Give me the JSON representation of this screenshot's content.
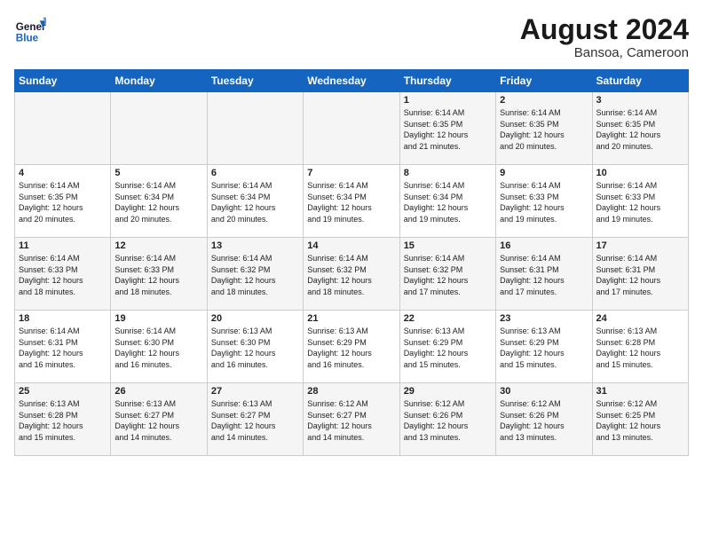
{
  "header": {
    "logo_general": "General",
    "logo_blue": "Blue",
    "month_year": "August 2024",
    "location": "Bansoa, Cameroon"
  },
  "weekdays": [
    "Sunday",
    "Monday",
    "Tuesday",
    "Wednesday",
    "Thursday",
    "Friday",
    "Saturday"
  ],
  "weeks": [
    [
      {
        "day": "",
        "info": ""
      },
      {
        "day": "",
        "info": ""
      },
      {
        "day": "",
        "info": ""
      },
      {
        "day": "",
        "info": ""
      },
      {
        "day": "1",
        "info": "Sunrise: 6:14 AM\nSunset: 6:35 PM\nDaylight: 12 hours\nand 21 minutes."
      },
      {
        "day": "2",
        "info": "Sunrise: 6:14 AM\nSunset: 6:35 PM\nDaylight: 12 hours\nand 20 minutes."
      },
      {
        "day": "3",
        "info": "Sunrise: 6:14 AM\nSunset: 6:35 PM\nDaylight: 12 hours\nand 20 minutes."
      }
    ],
    [
      {
        "day": "4",
        "info": "Sunrise: 6:14 AM\nSunset: 6:35 PM\nDaylight: 12 hours\nand 20 minutes."
      },
      {
        "day": "5",
        "info": "Sunrise: 6:14 AM\nSunset: 6:34 PM\nDaylight: 12 hours\nand 20 minutes."
      },
      {
        "day": "6",
        "info": "Sunrise: 6:14 AM\nSunset: 6:34 PM\nDaylight: 12 hours\nand 20 minutes."
      },
      {
        "day": "7",
        "info": "Sunrise: 6:14 AM\nSunset: 6:34 PM\nDaylight: 12 hours\nand 19 minutes."
      },
      {
        "day": "8",
        "info": "Sunrise: 6:14 AM\nSunset: 6:34 PM\nDaylight: 12 hours\nand 19 minutes."
      },
      {
        "day": "9",
        "info": "Sunrise: 6:14 AM\nSunset: 6:33 PM\nDaylight: 12 hours\nand 19 minutes."
      },
      {
        "day": "10",
        "info": "Sunrise: 6:14 AM\nSunset: 6:33 PM\nDaylight: 12 hours\nand 19 minutes."
      }
    ],
    [
      {
        "day": "11",
        "info": "Sunrise: 6:14 AM\nSunset: 6:33 PM\nDaylight: 12 hours\nand 18 minutes."
      },
      {
        "day": "12",
        "info": "Sunrise: 6:14 AM\nSunset: 6:33 PM\nDaylight: 12 hours\nand 18 minutes."
      },
      {
        "day": "13",
        "info": "Sunrise: 6:14 AM\nSunset: 6:32 PM\nDaylight: 12 hours\nand 18 minutes."
      },
      {
        "day": "14",
        "info": "Sunrise: 6:14 AM\nSunset: 6:32 PM\nDaylight: 12 hours\nand 18 minutes."
      },
      {
        "day": "15",
        "info": "Sunrise: 6:14 AM\nSunset: 6:32 PM\nDaylight: 12 hours\nand 17 minutes."
      },
      {
        "day": "16",
        "info": "Sunrise: 6:14 AM\nSunset: 6:31 PM\nDaylight: 12 hours\nand 17 minutes."
      },
      {
        "day": "17",
        "info": "Sunrise: 6:14 AM\nSunset: 6:31 PM\nDaylight: 12 hours\nand 17 minutes."
      }
    ],
    [
      {
        "day": "18",
        "info": "Sunrise: 6:14 AM\nSunset: 6:31 PM\nDaylight: 12 hours\nand 16 minutes."
      },
      {
        "day": "19",
        "info": "Sunrise: 6:14 AM\nSunset: 6:30 PM\nDaylight: 12 hours\nand 16 minutes."
      },
      {
        "day": "20",
        "info": "Sunrise: 6:13 AM\nSunset: 6:30 PM\nDaylight: 12 hours\nand 16 minutes."
      },
      {
        "day": "21",
        "info": "Sunrise: 6:13 AM\nSunset: 6:29 PM\nDaylight: 12 hours\nand 16 minutes."
      },
      {
        "day": "22",
        "info": "Sunrise: 6:13 AM\nSunset: 6:29 PM\nDaylight: 12 hours\nand 15 minutes."
      },
      {
        "day": "23",
        "info": "Sunrise: 6:13 AM\nSunset: 6:29 PM\nDaylight: 12 hours\nand 15 minutes."
      },
      {
        "day": "24",
        "info": "Sunrise: 6:13 AM\nSunset: 6:28 PM\nDaylight: 12 hours\nand 15 minutes."
      }
    ],
    [
      {
        "day": "25",
        "info": "Sunrise: 6:13 AM\nSunset: 6:28 PM\nDaylight: 12 hours\nand 15 minutes."
      },
      {
        "day": "26",
        "info": "Sunrise: 6:13 AM\nSunset: 6:27 PM\nDaylight: 12 hours\nand 14 minutes."
      },
      {
        "day": "27",
        "info": "Sunrise: 6:13 AM\nSunset: 6:27 PM\nDaylight: 12 hours\nand 14 minutes."
      },
      {
        "day": "28",
        "info": "Sunrise: 6:12 AM\nSunset: 6:27 PM\nDaylight: 12 hours\nand 14 minutes."
      },
      {
        "day": "29",
        "info": "Sunrise: 6:12 AM\nSunset: 6:26 PM\nDaylight: 12 hours\nand 13 minutes."
      },
      {
        "day": "30",
        "info": "Sunrise: 6:12 AM\nSunset: 6:26 PM\nDaylight: 12 hours\nand 13 minutes."
      },
      {
        "day": "31",
        "info": "Sunrise: 6:12 AM\nSunset: 6:25 PM\nDaylight: 12 hours\nand 13 minutes."
      }
    ]
  ]
}
